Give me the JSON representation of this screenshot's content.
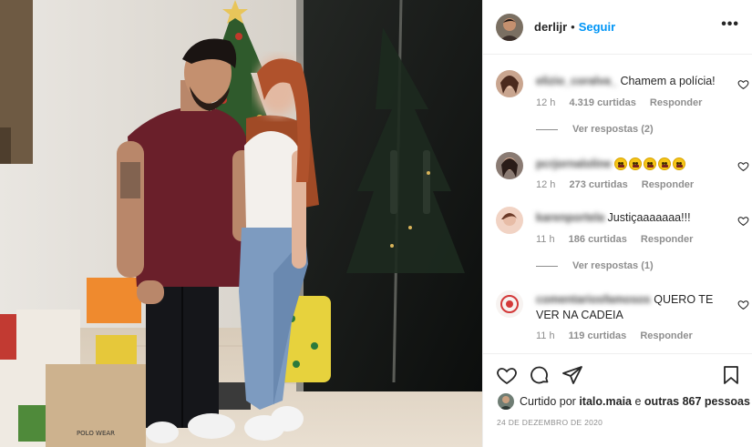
{
  "post": {
    "username": "derlijr",
    "separator": "•",
    "follow_label": "Seguir",
    "more_icon": "more-horizontal-icon"
  },
  "comments": [
    {
      "user": "elizio_coralva_",
      "text": "Chamem a polícia!",
      "time": "12 h",
      "likes": "4.319 curtidas",
      "reply_label": "Responder",
      "view_replies": "Ver respostas (2)"
    },
    {
      "user": "pcrjornaloline",
      "text": "",
      "emoji_count": 5,
      "emoji_icon": "furious-face-emoji",
      "time": "12 h",
      "likes": "273 curtidas",
      "reply_label": "Responder"
    },
    {
      "user": "karenportela",
      "text": "Justiçaaaaaaa!!!",
      "time": "11 h",
      "likes": "186 curtidas",
      "reply_label": "Responder",
      "view_replies": "Ver respostas (1)"
    },
    {
      "user": "comentariosfamosos",
      "text": "QUERO TE VER NA CADEIA",
      "time": "11 h",
      "likes": "119 curtidas",
      "reply_label": "Responder"
    }
  ],
  "footer": {
    "liked_prefix": "Curtido por",
    "liked_user": "italo.maia",
    "liked_conjunction": "e",
    "liked_others": "outras 867 pessoas",
    "date": "24 DE DEZEMBRO DE 2020"
  },
  "colors": {
    "link_blue": "#0095f6",
    "text_primary": "#262626",
    "text_secondary": "#8e8e8e",
    "border": "#efefef"
  }
}
